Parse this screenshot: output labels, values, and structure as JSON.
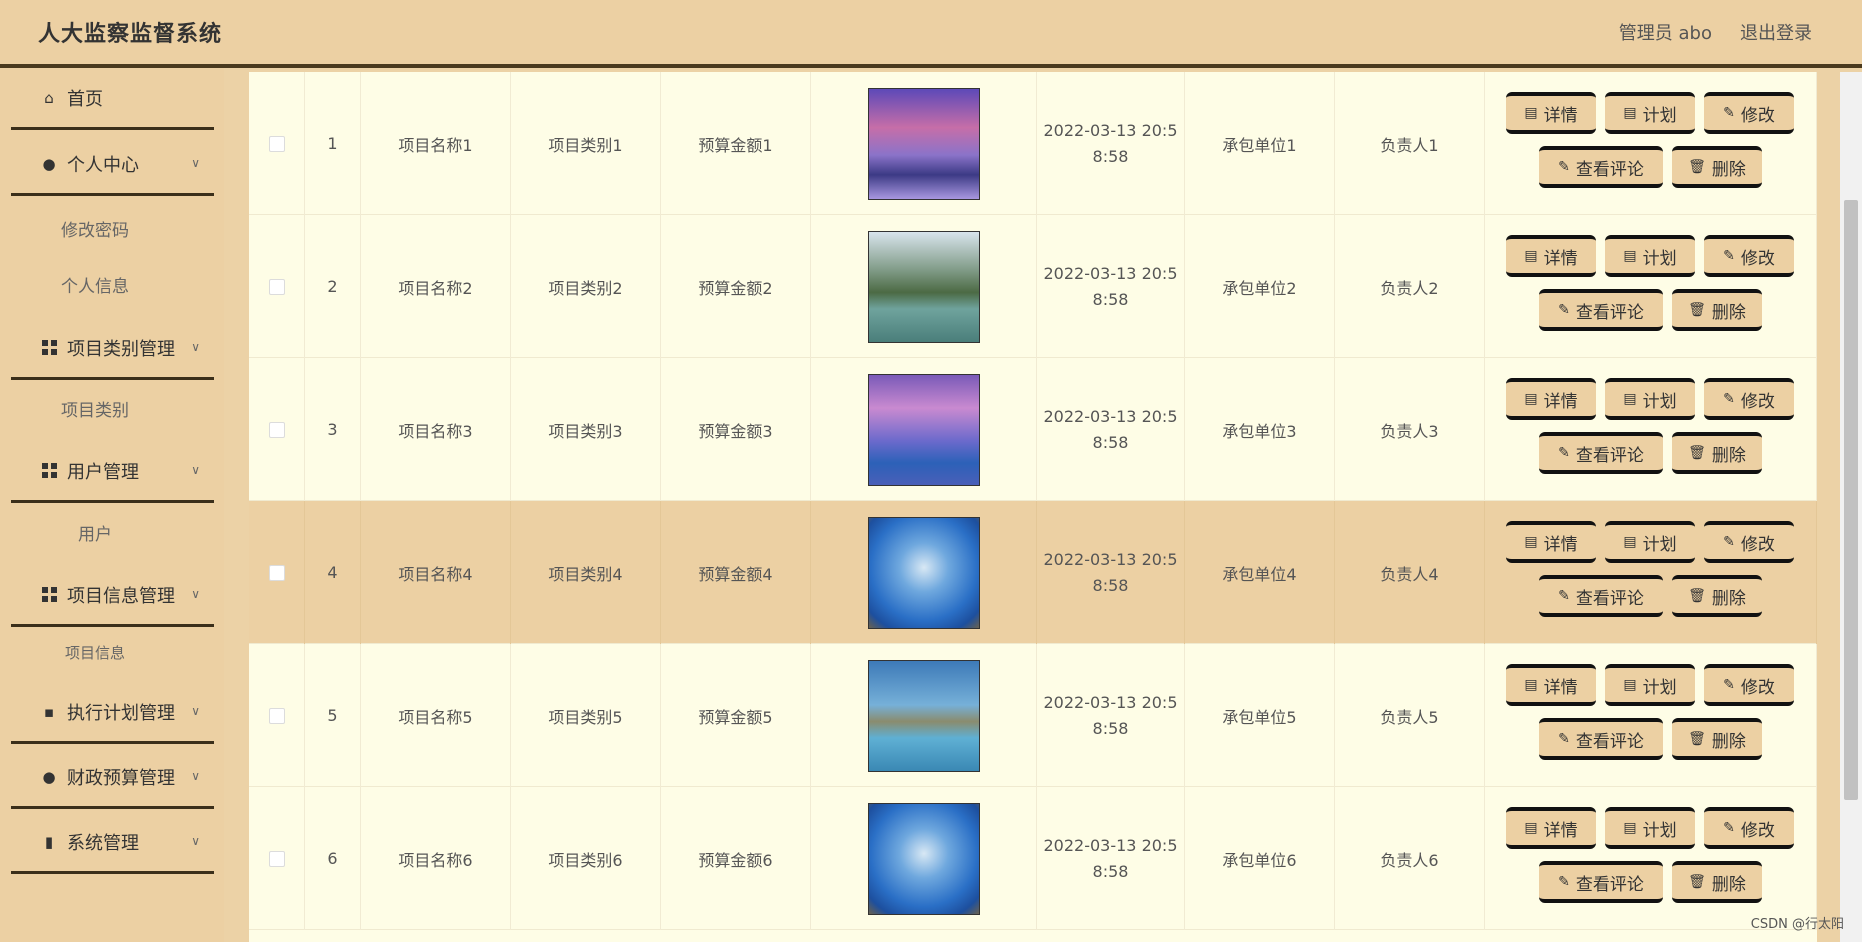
{
  "header": {
    "title": "人大监察监督系统",
    "user_label": "管理员 abo",
    "logout": "退出登录"
  },
  "sidebar": {
    "items": [
      {
        "label": "首页",
        "icon": "home-icon"
      },
      {
        "label": "个人中心",
        "icon": "user-icon"
      },
      {
        "label": "修改密码"
      },
      {
        "label": "个人信息"
      },
      {
        "label": "项目类别管理",
        "icon": "grid-icon"
      },
      {
        "label": "项目类别"
      },
      {
        "label": "用户管理",
        "icon": "grid-icon"
      },
      {
        "label": "用户"
      },
      {
        "label": "项目信息管理",
        "icon": "grid-icon"
      },
      {
        "label": "项目信息"
      },
      {
        "label": "执行计划管理",
        "icon": "chat-icon"
      },
      {
        "label": "财政预算管理",
        "icon": "user-icon"
      },
      {
        "label": "系统管理",
        "icon": "chart-icon"
      }
    ]
  },
  "table": {
    "rows": [
      {
        "index": "1",
        "name": "项目名称1",
        "category": "项目类别1",
        "budget": "预算金额1",
        "date1": "2022-03-13 20:5",
        "date2": "8:58",
        "contractor": "承包单位1",
        "manager": "负责人1"
      },
      {
        "index": "2",
        "name": "项目名称2",
        "category": "项目类别2",
        "budget": "预算金额2",
        "date1": "2022-03-13 20:5",
        "date2": "8:58",
        "contractor": "承包单位2",
        "manager": "负责人2"
      },
      {
        "index": "3",
        "name": "项目名称3",
        "category": "项目类别3",
        "budget": "预算金额3",
        "date1": "2022-03-13 20:5",
        "date2": "8:58",
        "contractor": "承包单位3",
        "manager": "负责人3"
      },
      {
        "index": "4",
        "name": "项目名称4",
        "category": "项目类别4",
        "budget": "预算金额4",
        "date1": "2022-03-13 20:5",
        "date2": "8:58",
        "contractor": "承包单位4",
        "manager": "负责人4"
      },
      {
        "index": "5",
        "name": "项目名称5",
        "category": "项目类别5",
        "budget": "预算金额5",
        "date1": "2022-03-13 20:5",
        "date2": "8:58",
        "contractor": "承包单位5",
        "manager": "负责人5"
      },
      {
        "index": "6",
        "name": "项目名称6",
        "category": "项目类别6",
        "budget": "预算金额6",
        "date1": "2022-03-13 20:5",
        "date2": "8:58",
        "contractor": "承包单位6",
        "manager": "负责人6"
      }
    ],
    "actions": {
      "detail": "详情",
      "plan": "计划",
      "edit": "修改",
      "comments": "查看评论",
      "delete": "删除"
    }
  },
  "watermark": "CSDN @行太阳",
  "colors": {
    "background": "#ecd2a6",
    "row": "#fefde6",
    "highlight_row": "#ecd0a3",
    "button": "#ecd0a3",
    "button_border": "#111111"
  }
}
